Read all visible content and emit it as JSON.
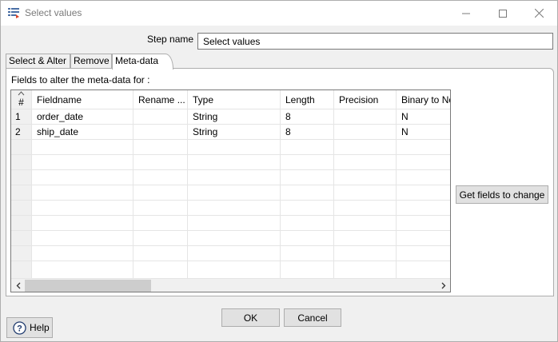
{
  "window": {
    "title": "Select values",
    "icon": "select-values-icon",
    "controls": [
      "minimize-icon",
      "maximize-icon",
      "close-icon"
    ]
  },
  "step": {
    "label": "Step name",
    "value": "Select values"
  },
  "tabs": [
    {
      "label": "Select & Alter",
      "active": false
    },
    {
      "label": "Remove",
      "active": false
    },
    {
      "label": "Meta-data",
      "active": true
    }
  ],
  "metadata": {
    "fields_label": "Fields to alter the meta-data for :",
    "columns": [
      "#",
      "Fieldname",
      "Rename ...",
      "Type",
      "Length",
      "Precision",
      "Binary to No"
    ],
    "rows": [
      {
        "num": "1",
        "fieldname": "order_date",
        "rename": "",
        "type": "String",
        "length": "8",
        "precision": "",
        "binary": "N"
      },
      {
        "num": "2",
        "fieldname": "ship_date",
        "rename": "",
        "type": "String",
        "length": "8",
        "precision": "",
        "binary": "N"
      }
    ],
    "get_fields_label": "Get fields to change"
  },
  "buttons": {
    "ok": "OK",
    "cancel": "Cancel",
    "help": "Help"
  },
  "colors": {
    "background": "#f0f0f0",
    "button": "#e1e1e1",
    "border": "#adadad"
  }
}
